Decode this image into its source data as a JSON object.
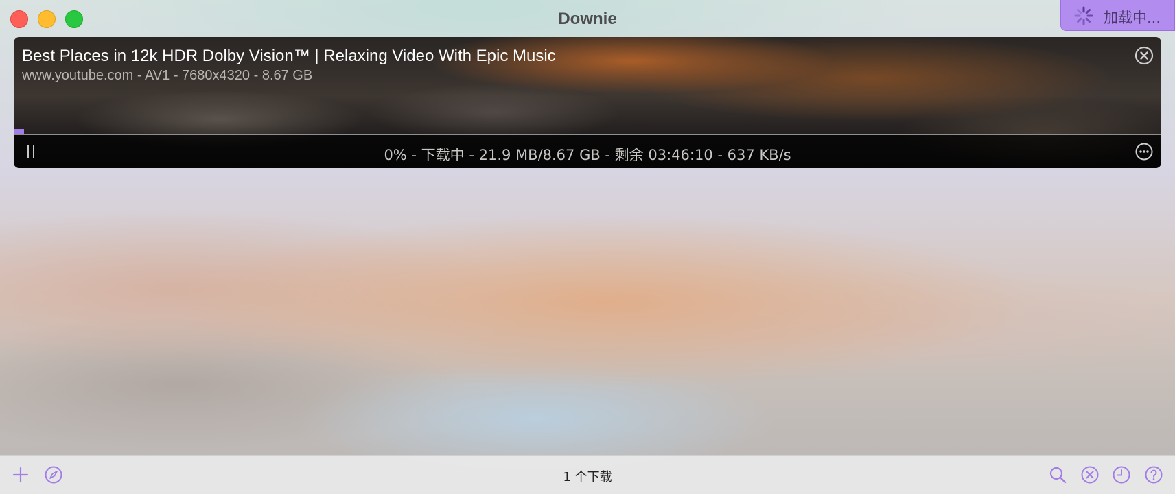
{
  "window": {
    "title": "Downie",
    "loading_label": "加载中..."
  },
  "download": {
    "title": "Best Places in 12k HDR Dolby Vision™ | Relaxing Video With Epic Music",
    "subtitle": "www.youtube.com - AV1 - 7680x4320 - 8.67 GB",
    "progress": 0.009,
    "status": "0% - 下载中 - 21.9 MB/8.67 GB - 剩余 03:46:10 - 637 KB/s"
  },
  "bottombar": {
    "count_label": "1 个下载"
  },
  "icons": {
    "add": "plus-icon",
    "browser": "compass-icon",
    "search": "search-icon",
    "cancel_all": "cancel-circle-icon",
    "history": "clock-icon",
    "help": "help-icon",
    "item_close": "close-circle-icon",
    "pause": "pause-icon",
    "more": "ellipsis-icon",
    "spinner": "spinner-icon"
  },
  "colors": {
    "accent": "#a27de8",
    "badge": "#b38cf0",
    "close": "#fe5f57",
    "minimize": "#febc2e",
    "maximize": "#28c840"
  }
}
